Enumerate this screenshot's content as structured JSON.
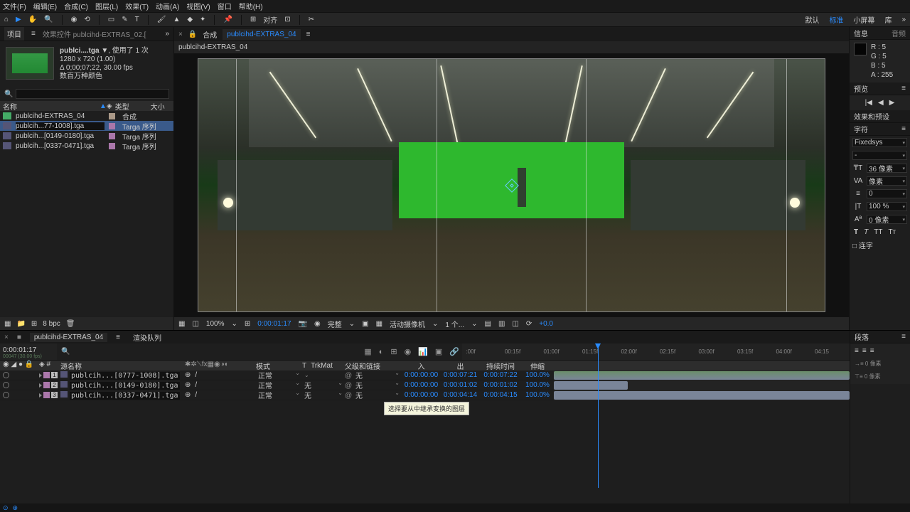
{
  "menu": {
    "file": "文件(F)",
    "edit": "编辑(E)",
    "comp": "合成(C)",
    "layer": "图层(L)",
    "effect": "效果(T)",
    "anim": "动画(A)",
    "view": "视图(V)",
    "window": "窗口",
    "help": "帮助(H)"
  },
  "workspace": {
    "default": "默认",
    "standard": "标准",
    "small": "小屏幕",
    "lib": "库"
  },
  "toolbar": {
    "snap": "对齐"
  },
  "project": {
    "tab": "项目",
    "fx_tab": "效果控件 publcihd-EXTRAS_02.[",
    "meta_name": "publci....tga ▼",
    "meta_used": ", 使用了 1 次",
    "meta_res": "1280 x 720 (1.00)",
    "meta_dur": "Δ 0;00;07;22, 30.00 fps",
    "meta_color": "数百万种颜色",
    "col_name": "名称",
    "col_type": "类型",
    "col_size": "大小",
    "items": [
      {
        "name": "publcihd-EXTRAS_04",
        "type": "合成",
        "sel": false,
        "comp": true
      },
      {
        "name": "publcih...77-1008].tga",
        "type": "Targa 序列",
        "sel": true,
        "comp": false
      },
      {
        "name": "publcih...[0149-0180].tga",
        "type": "Targa 序列",
        "sel": false,
        "comp": false
      },
      {
        "name": "publcih...[0337-0471].tga",
        "type": "Targa 序列",
        "sel": false,
        "comp": false
      }
    ],
    "bpc": "8 bpc"
  },
  "comp": {
    "prefix": "合成",
    "name": "publcihd-EXTRAS_04",
    "flow": "publcihd-EXTRAS_04"
  },
  "viewer": {
    "zoom": "100%",
    "time": "0:00:01:17",
    "res": "完整",
    "camera": "活动摄像机",
    "view": "1 个...",
    "exp": "+0.0"
  },
  "info": {
    "tab": "信息",
    "tab2": "音频",
    "r": "R : 5",
    "g": "G : 5",
    "b": "B : 5",
    "a": "A : 255"
  },
  "preview": {
    "tab": "预览"
  },
  "effects": {
    "tab": "效果和预设"
  },
  "char": {
    "tab": "字符",
    "font": "Fixedsys",
    "style": "-",
    "size": "36 像素",
    "lead": "像素",
    "kern": "0",
    "track": "100 %",
    "base": "0 像素",
    "b": "T",
    "i": "T",
    "tt": "TT",
    "sc": "Tᴛ",
    "lig": "□ 连字"
  },
  "para": {
    "tab": "段落"
  },
  "timeline": {
    "tab": "publcihd-EXTRAS_04",
    "tab2": "渲染队列",
    "time": "0:00:01:17",
    "col_src": "源名称",
    "col_mode": "模式",
    "col_trk": "TrkMat",
    "col_par": "父级和链接",
    "col_in": "入",
    "col_out": "出",
    "col_dur": "持续时间",
    "col_str": "伸缩",
    "ticks": [
      ":00f",
      "00:15f",
      "01:00f",
      "01:15f",
      "02:00f",
      "02:15f",
      "03:00f",
      "03:15f",
      "04:00f",
      "04:15"
    ],
    "sub": "00047 (30.00 fps)",
    "layers": [
      {
        "idx": "1",
        "name": "publcih...[0777-1008].tga",
        "mode": "正常",
        "trk": "",
        "par": "无",
        "in": "0:00:00:00",
        "out": "0:00:07:21",
        "dur": "0:00:07:22",
        "str": "100.0%",
        "clip": "a"
      },
      {
        "idx": "2",
        "name": "publcih...[0149-0180].tga",
        "mode": "正常",
        "trk": "无",
        "par": "无",
        "in": "0:00:00:00",
        "out": "0:00:01:02",
        "dur": "0:00:01:02",
        "str": "100.0%",
        "clip": "b"
      },
      {
        "idx": "3",
        "name": "publcih...[0337-0471].tga",
        "mode": "正常",
        "trk": "无",
        "par": "无",
        "in": "0:00:00:00",
        "out": "0:00:04:14",
        "dur": "0:00:04:15",
        "str": "100.0%",
        "clip": "c"
      }
    ],
    "tooltip": "选择要从中继承变换的图层"
  }
}
